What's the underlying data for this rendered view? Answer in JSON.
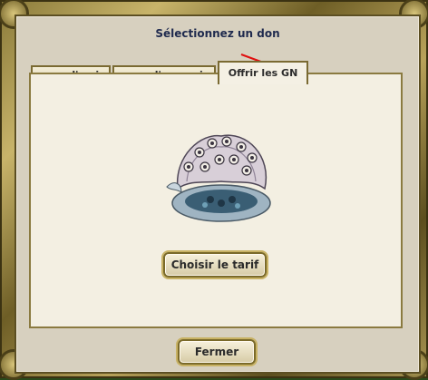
{
  "dialog": {
    "title": "Sélectionnez un don",
    "tabs": [
      {
        "label": "pour l'ami",
        "active": false
      },
      {
        "label": "pour l'ennemi",
        "active": false
      },
      {
        "label": "Offrir les GN",
        "active": true
      }
    ],
    "choose_price_button": "Choisir le tarif",
    "close_button": "Fermer",
    "gift_icon": "seashell-gift-icon"
  },
  "colors": {
    "title_text": "#1f2a4e",
    "arrow": "#e01010",
    "panel_bg": "#f3efe2",
    "frame_gold": "#b8a25a"
  }
}
